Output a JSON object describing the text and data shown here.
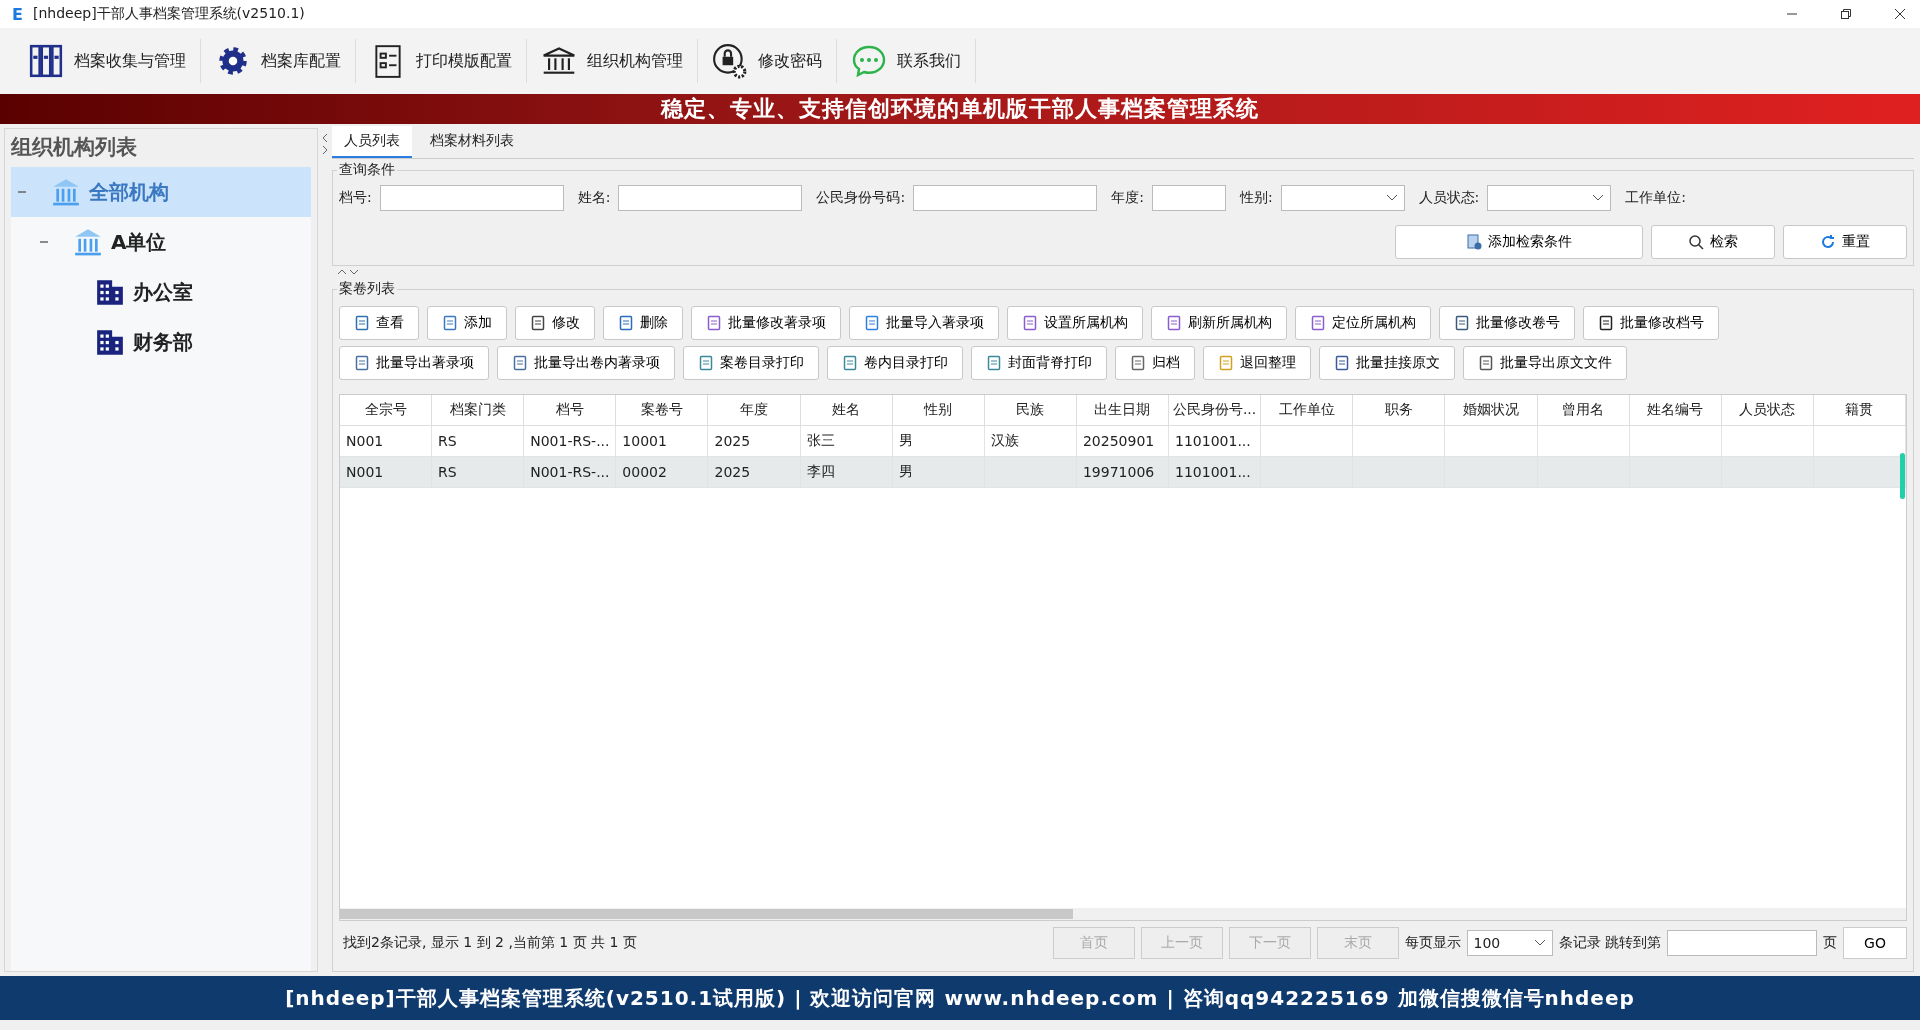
{
  "window": {
    "logo": "E",
    "title": "[nhdeep]干部人事档案管理系统(v2510.1)"
  },
  "toolbar": [
    {
      "label": "档案收集与管理",
      "kind": "binders"
    },
    {
      "label": "档案库配置",
      "kind": "gear"
    },
    {
      "label": "打印模版配置",
      "kind": "form"
    },
    {
      "label": "组织机构管理",
      "kind": "building"
    },
    {
      "label": "修改密码",
      "kind": "lock"
    },
    {
      "label": "联系我们",
      "kind": "chat"
    }
  ],
  "banner": "稳定、专业、支持信创环境的单机版干部人事档案管理系统",
  "sidebar": {
    "title": "组织机构列表",
    "tree": [
      {
        "label": "全部机构",
        "kind": "institution",
        "expanded": true,
        "selected": true,
        "children": [
          {
            "label": "A单位",
            "kind": "institution",
            "expanded": true,
            "selected": false,
            "children": [
              {
                "label": "办公室",
                "kind": "office",
                "selected": false
              },
              {
                "label": "财务部",
                "kind": "office",
                "selected": false
              }
            ]
          }
        ]
      }
    ]
  },
  "tabs": [
    {
      "label": "人员列表",
      "selected": true
    },
    {
      "label": "档案材料列表",
      "selected": false
    }
  ],
  "query": {
    "title": "查询条件",
    "fields": [
      {
        "label": "档号:",
        "kind": "text"
      },
      {
        "label": "姓名:",
        "kind": "text"
      },
      {
        "label": "公民身份号码:",
        "kind": "text"
      },
      {
        "label": "年度:",
        "kind": "short"
      },
      {
        "label": "性别:",
        "kind": "select"
      },
      {
        "label": "人员状态:",
        "kind": "select"
      },
      {
        "label": "工作单位:",
        "kind": "label"
      }
    ],
    "buttons": [
      {
        "label": "添加检索条件",
        "kind": "add"
      },
      {
        "label": "检索",
        "kind": "search"
      },
      {
        "label": "重置",
        "kind": "reset"
      }
    ]
  },
  "records": {
    "title": "案卷列表",
    "actions": [
      [
        {
          "label": "查看",
          "kind": "doc"
        },
        {
          "label": "添加",
          "kind": "add"
        },
        {
          "label": "修改",
          "kind": "edit"
        },
        {
          "label": "删除",
          "kind": "trash"
        },
        {
          "label": "批量修改著录项",
          "kind": "purple"
        },
        {
          "label": "批量导入著录项",
          "kind": "import"
        },
        {
          "label": "设置所属机构",
          "kind": "purple"
        },
        {
          "label": "刷新所属机构",
          "kind": "purple"
        },
        {
          "label": "定位所属机构",
          "kind": "purple"
        },
        {
          "label": "批量修改卷号",
          "kind": "num"
        },
        {
          "label": "批量修改档号",
          "kind": "hash"
        }
      ],
      [
        {
          "label": "批量导出著录项",
          "kind": "export"
        },
        {
          "label": "批量导出卷内著录项",
          "kind": "export"
        },
        {
          "label": "案卷目录打印",
          "kind": "print"
        },
        {
          "label": "卷内目录打印",
          "kind": "print"
        },
        {
          "label": "封面背脊打印",
          "kind": "print"
        },
        {
          "label": "归档",
          "kind": "archive"
        },
        {
          "label": "退回整理",
          "kind": "return"
        },
        {
          "label": "批量挂接原文",
          "kind": "link"
        },
        {
          "label": "批量导出原文文件",
          "kind": "file"
        }
      ]
    ],
    "table": {
      "columns": [
        "全宗号",
        "档案门类",
        "档号",
        "案卷号",
        "年度",
        "姓名",
        "性别",
        "民族",
        "出生日期",
        "公民身份号...",
        "工作单位",
        "职务",
        "婚姻状况",
        "曾用名",
        "姓名编号",
        "人员状态",
        "籍贯"
      ],
      "rows": [
        {
          "selected": false,
          "cells": [
            "N001",
            "RS",
            "N001-RS-...",
            "10001",
            "2025",
            "张三",
            "男",
            "汉族",
            "20250901",
            "1101001...",
            "",
            "",
            "",
            "",
            "",
            "",
            ""
          ]
        },
        {
          "selected": true,
          "cells": [
            "N001",
            "RS",
            "N001-RS-...",
            "00002",
            "2025",
            "李四",
            "男",
            "",
            "19971006",
            "1101001...",
            "",
            "",
            "",
            "",
            "",
            "",
            ""
          ]
        }
      ]
    },
    "status": "找到2条记录, 显示 1 到 2 ,当前第 1 页 共 1 页",
    "pager": [
      {
        "label": "首页",
        "disabled": true
      },
      {
        "label": "上一页",
        "disabled": true
      },
      {
        "label": "下一页",
        "disabled": true
      },
      {
        "label": "末页",
        "disabled": true
      }
    ],
    "page_size_label": "每页显示",
    "page_size": "100",
    "records_label": "条记录 跳转到第",
    "page_label": "页",
    "go": "GO"
  },
  "footer": "[nhdeep]干部人事档案管理系统(v2510.1试用版) | 欢迎访问官网 www.nhdeep.com | 咨询qq942225169 加微信搜微信号nhdeep"
}
